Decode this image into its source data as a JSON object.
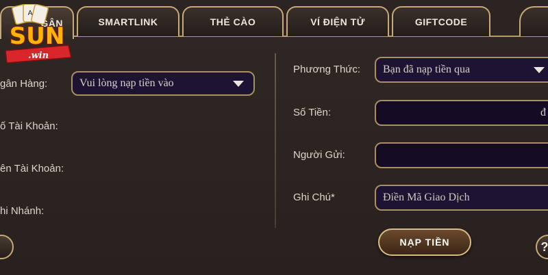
{
  "logo": {
    "brand": "SUN",
    "sub": "win"
  },
  "tabs": [
    {
      "label": "GÂN"
    },
    {
      "label": "SMARTLINK"
    },
    {
      "label": "THẺ CÀO"
    },
    {
      "label": "VÍ ĐIỆN TỬ"
    },
    {
      "label": "GIFTCODE"
    }
  ],
  "left": {
    "bank_label": "gân Hàng:",
    "bank_value": "Vui lòng nạp tiền vào",
    "account_number_label": "ố Tài Khoản:",
    "account_name_label": "ên Tài Khoản:",
    "branch_label": "hi Nhánh:"
  },
  "right": {
    "method_label": "Phương Thức:",
    "method_value": "Bạn đã nạp tiền qua",
    "amount_label": "Số Tiền:",
    "amount_suffix": "đ",
    "sender_label": "Người Gửi:",
    "note_label": "Ghi Chú*",
    "note_placeholder": "Điền Mã Giao Dịch"
  },
  "submit_label": "NẠP TIỀN",
  "corner_right": "?",
  "colors": {
    "border_gold": "#c6ab78",
    "field_bg": "#1d1332",
    "panel_bg": "#2b2420"
  }
}
